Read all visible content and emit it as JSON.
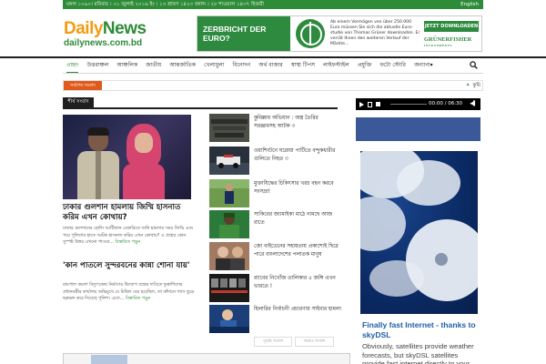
{
  "topbar": {
    "date": "মঙ্গল ১০৯০। রবিবার । ০১ জুলাই ২০১৬ ইং । ১৩ শ্রাবণ ১৪২৩ বঙ্গাব্দ । ২৮ শাওয়াল ১৪৩৭ হিজরী",
    "language": "English"
  },
  "header": {
    "logo_part1": "Daily",
    "logo_part2": "News",
    "logo_url": "dailynews.com.bd"
  },
  "ad_banner": {
    "headline": "ZERBRICHT DER EURO?",
    "text": "Ab einem Vermögen von über 250.000 Euro müssen Sie sich die aktuelle Euro-studie von Thomas Grüner downloaden. Er verrät Ihnen den weiteren Verlauf der Märkte...",
    "button": "JETZT DOWNLOADEN",
    "brand": "GRÜNERFISHER",
    "brand_sub": "INVESTMENTS"
  },
  "nav": {
    "items": [
      "প্রচ্ছদ",
      "উত্তরাঞ্চল",
      "আঞ্চলিক",
      "জাতীয়",
      "আন্তর্জাতিক",
      "খেলাধুলা",
      "বিনোদন",
      "অর্থ বাজার",
      "স্বাস্থ্য টিপস",
      "লাইফস্টাইল",
      "প্রযুক্তি",
      "ফটো স্টোরি",
      "অন্যান্য"
    ],
    "more_arrow": "▾"
  },
  "breaking": {
    "label": "সর্বশেষ সংবাদ",
    "ticker": "কুমি"
  },
  "section": {
    "label": "শীর্ষ সংবাদ"
  },
  "main_story": {
    "title": "ঢাকার গুলশান হামলায় জিম্মি হাসনাত করিম এখন কোথায়?",
    "summary": "ঢাকার গুলশানের হোলি আর্টিজান বেকারিতে জঙ্গি হামলার সময় জিম্মি এবং পরে পুলিশের হাতে আটক হাসনাত করিম এখন কোথায়? এ প্রশ্নের কোন সুস্পষ্ট উত্তর এখনো পাওয়া...",
    "read_more": "বিস্তারিত পড়ুন"
  },
  "second_story": {
    "title": "'কান পাতলে সুন্দরবনের কান্না শোনা যায়'",
    "summary": "রামপাল কয়লা বিদ্যুৎকেন্দ্র নির্মাণের উদ্যোগ বন্ধের দাবিতে ফুপ্পাশিলের প্রধানমন্ত্রীর কার্যালয় অভিমুখে যে মিছিল বের হয়েছিল, তা কাঁদানে গ্যাস ছুড়ে ছত্রভঙ্গ করে দিয়েছে পুলিশ। এতে...",
    "read_more": "বিস্তারিত পড়ুন"
  },
  "news_list": [
    {
      "title": "কুমিল্লায় অভিযান : অস্ত্র তৈরির সরঞ্জামসহ আটক ৩"
    },
    {
      "title": "ওয়াশিংটনে ঘরোয়া পার্টিতে বন্দুকধারীর গুলিতে নিহত ৩"
    },
    {
      "title": "মুক্তাযিদ্ধের চিকিৎসার খরচ বহন করবে সংসদ্রা!"
    },
    {
      "title": "সাকিবের জ্যামাইকা মাঠে নামছে আজ রাতে"
    },
    {
      "title": "জো বাইডেনের সহায়তায় প্রকাশ্যেই ছিরে পারে বাংলাদেশের পলাতক মানুষ"
    },
    {
      "title": "র‍্যাবের নিখোঁজ তালিকার ৫ জঙ্গি এখন ভারতে !"
    },
    {
      "title": "হিলারির নির্বাচনী প্রচারণায় সাইবার হামলা"
    }
  ],
  "pager": {
    "prev": "পূর্বের সংবাদ",
    "next": "আরও সংবাদ"
  },
  "audio": {
    "time": "00:00 / 06:30"
  },
  "ad_right": {
    "title": "Finally fast Internet - thanks to skyDSL",
    "text": "Obviously, satellites provide weather forecasts, but skyDSL satellites provide fast internet directly to your"
  }
}
